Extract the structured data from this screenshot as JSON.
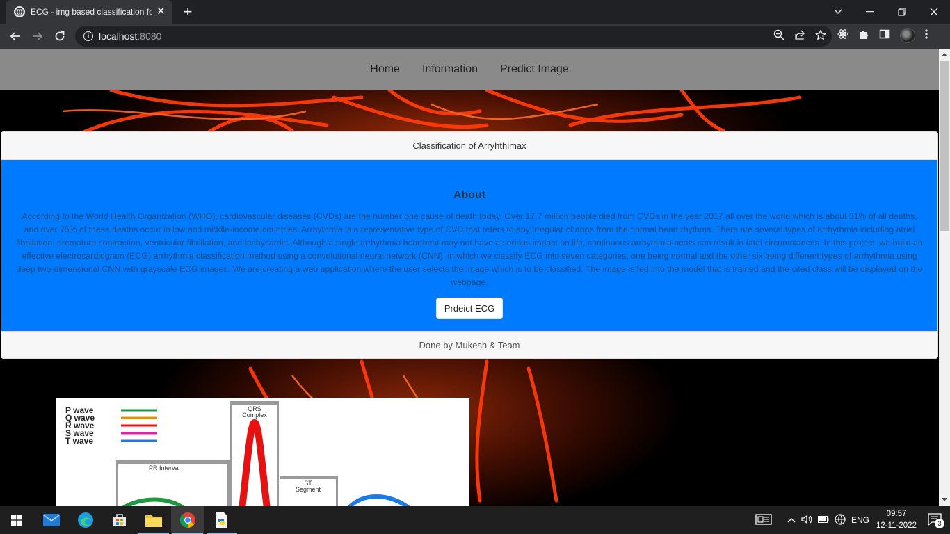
{
  "browser": {
    "tab_title": "ECG - img based classification fo",
    "tab_close": "✕",
    "new_tab": "+",
    "url_host": "localhost",
    "url_port": ":8080"
  },
  "site_nav": {
    "items": [
      "Home",
      "Information",
      "Predict Image"
    ]
  },
  "card": {
    "header": "Classification of Arryhthimax",
    "about_title": "About",
    "about_text": "According to the World Health Organization (WHO), cardiovascular diseases (CVDs) are the number one cause of death today. Over 17.7 million people died from CVDs in the year 2017 all over the world which is about 31% of all deaths, and over 75% of these deaths occur in low and middle-income countries. Arrhythmia is a representative type of CVD that refers to any irregular change from the normal heart rhythms. There are several types of arrhythmia including atrial fibrillation, premature contraction, ventricular fibrillation, and tachycardia. Although a single arrhythmia heartbeat may not have a serious impact on life, continuous arrhythmia beats can result in fatal circumstances. In this project, we build an effective electrocardiogram (ECG) arrhythmia classification method using a convolutional neural network (CNN), in which we classify ECG into seven categories, one being normal and the other six being different types of arrhythmia using deep two-dimensional CNN with grayscale ECG images. We are creating a web application where the user selects the image which is to be classified. The image is fed into the model that is trained and the cited class will be displayed on the webpage.",
    "button": "Prdeict ECG",
    "footer": "Done by Mukesh & Team"
  },
  "ecg_figure": {
    "legend": [
      {
        "label": "P wave",
        "color": "#1a9a3c"
      },
      {
        "label": "Q wave",
        "color": "#f08c00"
      },
      {
        "label": "R wave",
        "color": "#e81010"
      },
      {
        "label": "S wave",
        "color": "#e020b0"
      },
      {
        "label": "T wave",
        "color": "#1a7ae8"
      }
    ],
    "pr_interval": "PR Interval",
    "qrs_complex": [
      "QRS",
      "Complex"
    ],
    "st_segment": [
      "ST",
      "Segment"
    ]
  },
  "taskbar": {
    "lang": "ENG",
    "time": "09:57",
    "date": "12-11-2022",
    "notifications": "3"
  }
}
